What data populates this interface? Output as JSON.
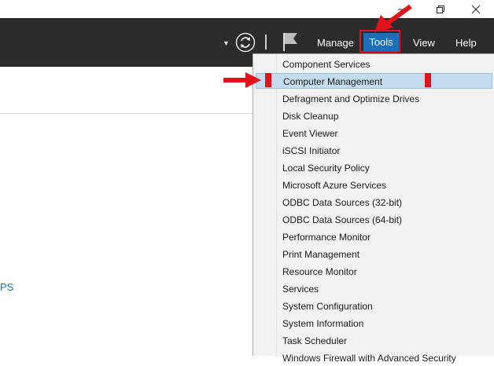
{
  "window": {
    "minimize_icon": "minimize-icon",
    "restore_icon": "restore-icon",
    "close_icon": "close-icon"
  },
  "toolbar": {
    "menus": [
      {
        "label": "Manage"
      },
      {
        "label": "Tools"
      },
      {
        "label": "View"
      },
      {
        "label": "Help"
      }
    ],
    "accent_color": "#1c6fb8",
    "background_color": "#2b2b2b"
  },
  "content": {
    "partial_link_text": "PS"
  },
  "tools_menu": {
    "items": [
      {
        "label": "Component Services"
      },
      {
        "label": "Computer Management"
      },
      {
        "label": "Defragment and Optimize Drives"
      },
      {
        "label": "Disk Cleanup"
      },
      {
        "label": "Event Viewer"
      },
      {
        "label": "iSCSI Initiator"
      },
      {
        "label": "Local Security Policy"
      },
      {
        "label": "Microsoft Azure Services"
      },
      {
        "label": "ODBC Data Sources (32-bit)"
      },
      {
        "label": "ODBC Data Sources (64-bit)"
      },
      {
        "label": "Performance Monitor"
      },
      {
        "label": "Print Management"
      },
      {
        "label": "Resource Monitor"
      },
      {
        "label": "Services"
      },
      {
        "label": "System Configuration"
      },
      {
        "label": "System Information"
      },
      {
        "label": "Task Scheduler"
      },
      {
        "label": "Windows Firewall with Advanced Security"
      }
    ],
    "selected_item": "Computer Management",
    "highlight_color": "#c3dcee",
    "annotation_color": "#e0141a"
  }
}
